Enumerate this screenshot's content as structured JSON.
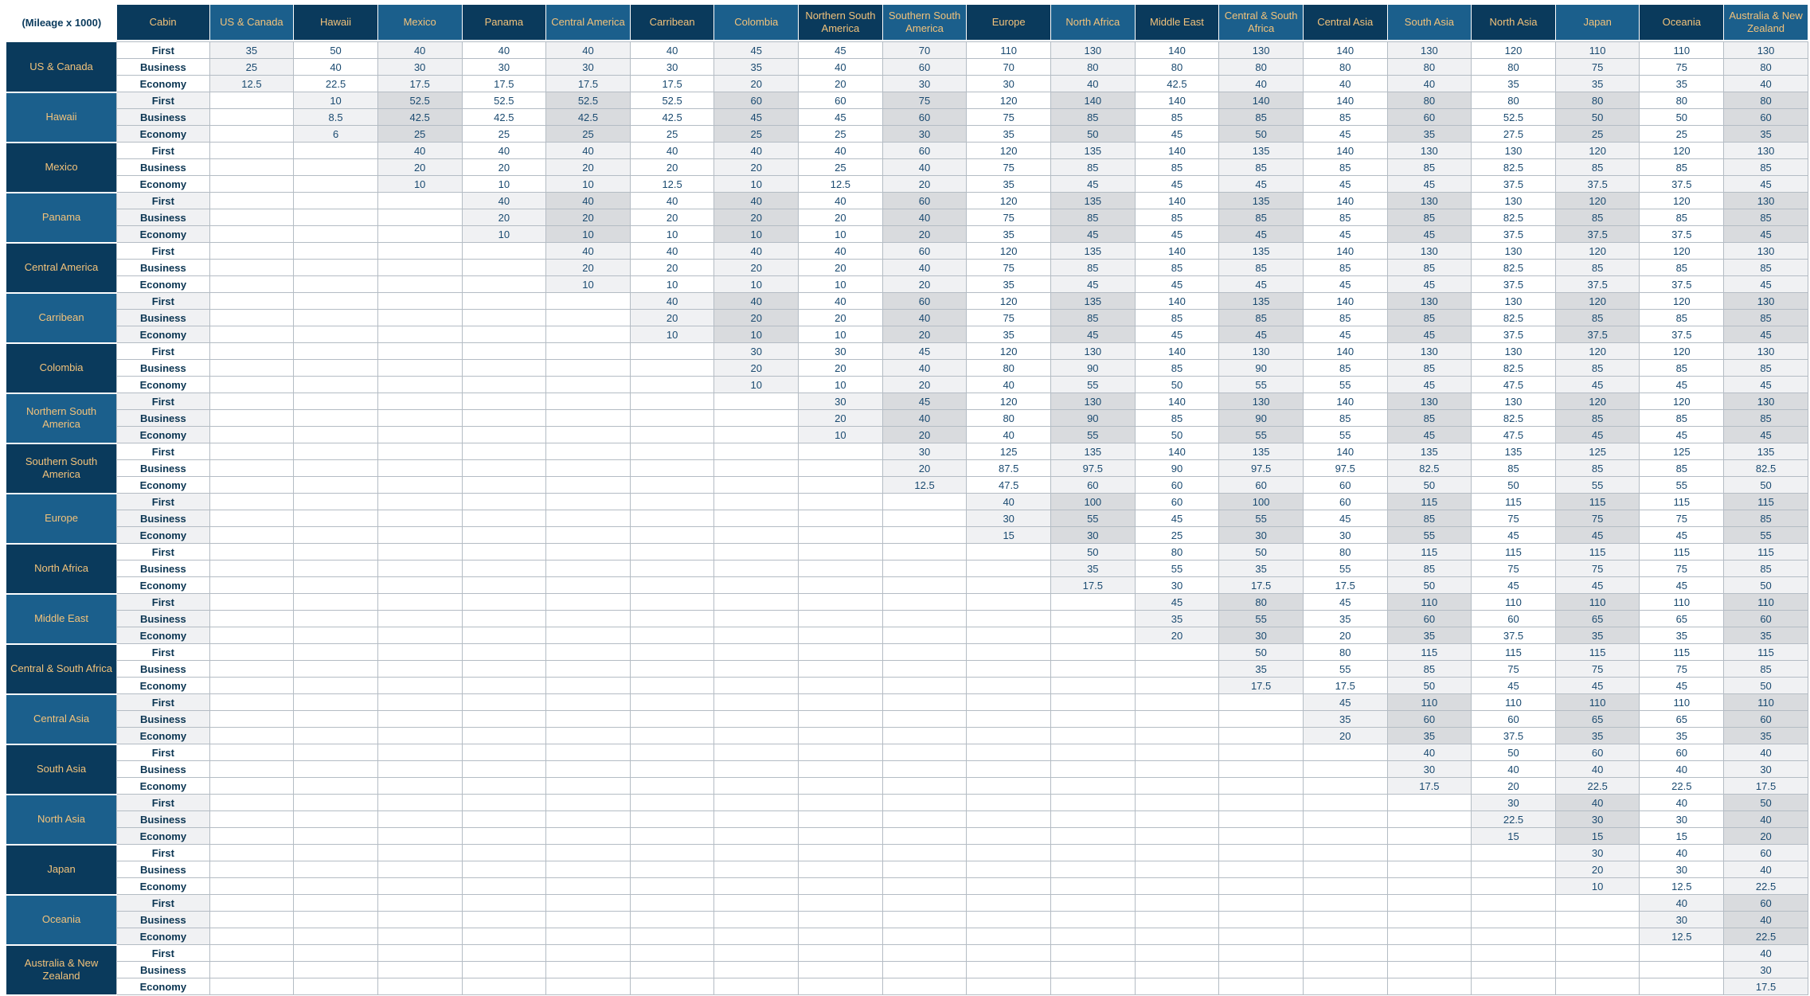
{
  "corner_label": "(Mileage x 1000)",
  "cabin_header": "Cabin",
  "regions": [
    "US & Canada",
    "Hawaii",
    "Mexico",
    "Panama",
    "Central America",
    "Carribean",
    "Colombia",
    "Northern South America",
    "Southern South America",
    "Europe",
    "North Africa",
    "Middle East",
    "Central & South Africa",
    "Central Asia",
    "South Asia",
    "North Asia",
    "Japan",
    "Oceania",
    "Australia & New Zealand"
  ],
  "cabins": [
    "First",
    "Business",
    "Economy"
  ],
  "rows": [
    {
      "region": "US & Canada",
      "first": [
        "35",
        "50",
        "40",
        "40",
        "40",
        "40",
        "45",
        "45",
        "70",
        "110",
        "130",
        "140",
        "130",
        "140",
        "130",
        "120",
        "110",
        "110",
        "130"
      ],
      "business": [
        "25",
        "40",
        "30",
        "30",
        "30",
        "30",
        "35",
        "40",
        "60",
        "70",
        "80",
        "80",
        "80",
        "80",
        "80",
        "80",
        "75",
        "75",
        "80"
      ],
      "economy": [
        "12.5",
        "22.5",
        "17.5",
        "17.5",
        "17.5",
        "17.5",
        "20",
        "20",
        "30",
        "30",
        "40",
        "42.5",
        "40",
        "40",
        "40",
        "35",
        "35",
        "35",
        "40"
      ]
    },
    {
      "region": "Hawaii",
      "first": [
        "10",
        "52.5",
        "52.5",
        "52.5",
        "52.5",
        "60",
        "60",
        "75",
        "120",
        "140",
        "140",
        "140",
        "140",
        "80",
        "80",
        "80",
        "80",
        "80"
      ],
      "business": [
        "8.5",
        "42.5",
        "42.5",
        "42.5",
        "42.5",
        "45",
        "45",
        "60",
        "75",
        "85",
        "85",
        "85",
        "85",
        "60",
        "52.5",
        "50",
        "50",
        "60"
      ],
      "economy": [
        "6",
        "25",
        "25",
        "25",
        "25",
        "25",
        "25",
        "30",
        "35",
        "50",
        "45",
        "50",
        "45",
        "35",
        "27.5",
        "25",
        "25",
        "35"
      ]
    },
    {
      "region": "Mexico",
      "first": [
        "40",
        "40",
        "40",
        "40",
        "40",
        "40",
        "60",
        "120",
        "135",
        "140",
        "135",
        "140",
        "130",
        "130",
        "120",
        "120",
        "130"
      ],
      "business": [
        "20",
        "20",
        "20",
        "20",
        "20",
        "25",
        "40",
        "75",
        "85",
        "85",
        "85",
        "85",
        "85",
        "82.5",
        "85",
        "85",
        "85"
      ],
      "economy": [
        "10",
        "10",
        "10",
        "12.5",
        "10",
        "12.5",
        "20",
        "35",
        "45",
        "45",
        "45",
        "45",
        "45",
        "37.5",
        "37.5",
        "37.5",
        "45"
      ]
    },
    {
      "region": "Panama",
      "first": [
        "40",
        "40",
        "40",
        "40",
        "40",
        "60",
        "120",
        "135",
        "140",
        "135",
        "140",
        "130",
        "130",
        "120",
        "120",
        "130"
      ],
      "business": [
        "20",
        "20",
        "20",
        "20",
        "20",
        "40",
        "75",
        "85",
        "85",
        "85",
        "85",
        "85",
        "82.5",
        "85",
        "85",
        "85"
      ],
      "economy": [
        "10",
        "10",
        "10",
        "10",
        "10",
        "20",
        "35",
        "45",
        "45",
        "45",
        "45",
        "45",
        "37.5",
        "37.5",
        "37.5",
        "45"
      ]
    },
    {
      "region": "Central America",
      "first": [
        "40",
        "40",
        "40",
        "40",
        "60",
        "120",
        "135",
        "140",
        "135",
        "140",
        "130",
        "130",
        "120",
        "120",
        "130"
      ],
      "business": [
        "20",
        "20",
        "20",
        "20",
        "40",
        "75",
        "85",
        "85",
        "85",
        "85",
        "85",
        "82.5",
        "85",
        "85",
        "85"
      ],
      "economy": [
        "10",
        "10",
        "10",
        "10",
        "20",
        "35",
        "45",
        "45",
        "45",
        "45",
        "45",
        "37.5",
        "37.5",
        "37.5",
        "45"
      ]
    },
    {
      "region": "Carribean",
      "first": [
        "40",
        "40",
        "40",
        "60",
        "120",
        "135",
        "140",
        "135",
        "140",
        "130",
        "130",
        "120",
        "120",
        "130"
      ],
      "business": [
        "20",
        "20",
        "20",
        "40",
        "75",
        "85",
        "85",
        "85",
        "85",
        "85",
        "82.5",
        "85",
        "85",
        "85"
      ],
      "economy": [
        "10",
        "10",
        "10",
        "20",
        "35",
        "45",
        "45",
        "45",
        "45",
        "45",
        "37.5",
        "37.5",
        "37.5",
        "45"
      ]
    },
    {
      "region": "Colombia",
      "first": [
        "30",
        "30",
        "45",
        "120",
        "130",
        "140",
        "130",
        "140",
        "130",
        "130",
        "120",
        "120",
        "130"
      ],
      "business": [
        "20",
        "20",
        "40",
        "80",
        "90",
        "85",
        "90",
        "85",
        "85",
        "82.5",
        "85",
        "85",
        "85"
      ],
      "economy": [
        "10",
        "10",
        "20",
        "40",
        "55",
        "50",
        "55",
        "55",
        "45",
        "47.5",
        "45",
        "45",
        "45"
      ]
    },
    {
      "region": "Northern South America",
      "first": [
        "30",
        "45",
        "120",
        "130",
        "140",
        "130",
        "140",
        "130",
        "130",
        "120",
        "120",
        "130"
      ],
      "business": [
        "20",
        "40",
        "80",
        "90",
        "85",
        "90",
        "85",
        "85",
        "82.5",
        "85",
        "85",
        "85"
      ],
      "economy": [
        "10",
        "20",
        "40",
        "55",
        "50",
        "55",
        "55",
        "45",
        "47.5",
        "45",
        "45",
        "45"
      ]
    },
    {
      "region": "Southern South America",
      "first": [
        "30",
        "125",
        "135",
        "140",
        "135",
        "140",
        "135",
        "135",
        "125",
        "125",
        "135"
      ],
      "business": [
        "20",
        "87.5",
        "97.5",
        "90",
        "97.5",
        "97.5",
        "82.5",
        "85",
        "85",
        "85",
        "82.5"
      ],
      "economy": [
        "12.5",
        "47.5",
        "60",
        "60",
        "60",
        "60",
        "50",
        "50",
        "55",
        "55",
        "50"
      ]
    },
    {
      "region": "Europe",
      "first": [
        "40",
        "100",
        "60",
        "100",
        "60",
        "115",
        "115",
        "115",
        "115",
        "115"
      ],
      "business": [
        "30",
        "55",
        "45",
        "55",
        "45",
        "85",
        "75",
        "75",
        "75",
        "85"
      ],
      "economy": [
        "15",
        "30",
        "25",
        "30",
        "30",
        "55",
        "45",
        "45",
        "45",
        "55"
      ]
    },
    {
      "region": "North Africa",
      "first": [
        "50",
        "80",
        "50",
        "80",
        "115",
        "115",
        "115",
        "115",
        "115"
      ],
      "business": [
        "35",
        "55",
        "35",
        "55",
        "85",
        "75",
        "75",
        "75",
        "85"
      ],
      "economy": [
        "17.5",
        "30",
        "17.5",
        "17.5",
        "50",
        "45",
        "45",
        "45",
        "50"
      ]
    },
    {
      "region": "Middle East",
      "first": [
        "45",
        "80",
        "45",
        "110",
        "110",
        "110",
        "110",
        "110"
      ],
      "business": [
        "35",
        "55",
        "35",
        "60",
        "60",
        "65",
        "65",
        "60"
      ],
      "economy": [
        "20",
        "30",
        "20",
        "35",
        "37.5",
        "35",
        "35",
        "35"
      ]
    },
    {
      "region": "Central & South Africa",
      "first": [
        "50",
        "80",
        "115",
        "115",
        "115",
        "115",
        "115"
      ],
      "business": [
        "35",
        "55",
        "85",
        "75",
        "75",
        "75",
        "85"
      ],
      "economy": [
        "17.5",
        "17.5",
        "50",
        "45",
        "45",
        "45",
        "50"
      ]
    },
    {
      "region": "Central Asia",
      "first": [
        "45",
        "110",
        "110",
        "110",
        "110",
        "110"
      ],
      "business": [
        "35",
        "60",
        "60",
        "65",
        "65",
        "60"
      ],
      "economy": [
        "20",
        "35",
        "37.5",
        "35",
        "35",
        "35"
      ]
    },
    {
      "region": "South Asia",
      "first": [
        "40",
        "50",
        "60",
        "60",
        "40"
      ],
      "business": [
        "30",
        "40",
        "40",
        "40",
        "30"
      ],
      "economy": [
        "17.5",
        "20",
        "22.5",
        "22.5",
        "17.5"
      ]
    },
    {
      "region": "North Asia",
      "first": [
        "30",
        "40",
        "40",
        "50"
      ],
      "business": [
        "22.5",
        "30",
        "30",
        "40"
      ],
      "economy": [
        "15",
        "15",
        "15",
        "20"
      ]
    },
    {
      "region": "Japan",
      "first": [
        "30",
        "40",
        "60"
      ],
      "business": [
        "20",
        "30",
        "40"
      ],
      "economy": [
        "10",
        "12.5",
        "22.5"
      ]
    },
    {
      "region": "Oceania",
      "first": [
        "40",
        "60"
      ],
      "business": [
        "30",
        "40"
      ],
      "economy": [
        "12.5",
        "22.5"
      ]
    },
    {
      "region": "Australia & New Zealand",
      "first": [
        "40"
      ],
      "business": [
        "30"
      ],
      "economy": [
        "17.5"
      ]
    }
  ],
  "colors": {
    "header_dark": "#0a3a5c",
    "header_light": "#1b5f8c",
    "header_text": "#f2c27a",
    "value_text": "#1a4a70",
    "shade_light": "#f0f1f3",
    "shade_dark": "#d9dbde"
  }
}
